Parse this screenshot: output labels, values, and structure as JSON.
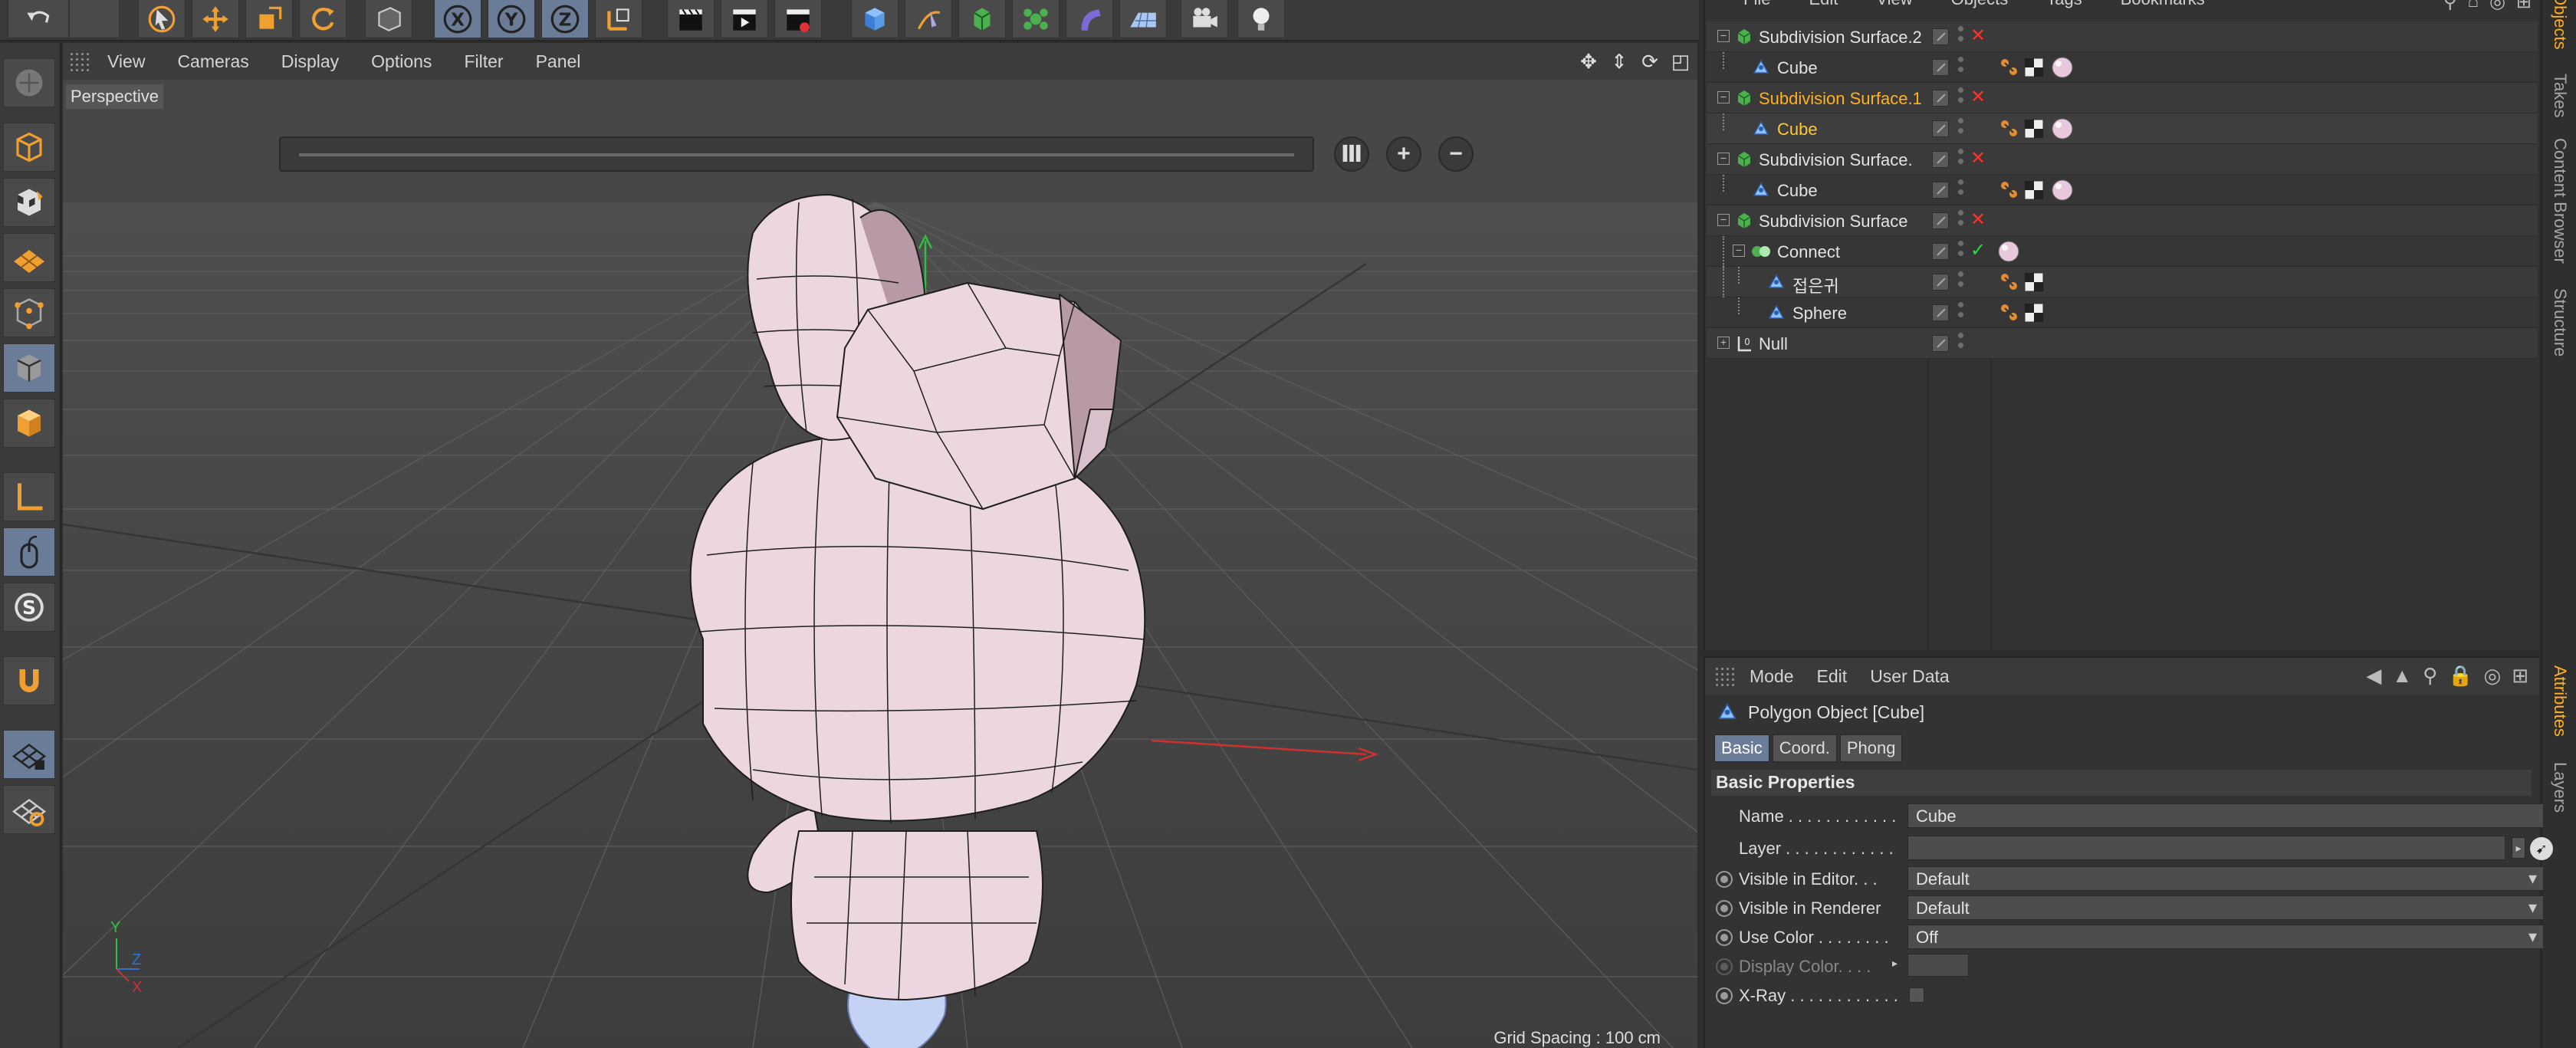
{
  "viewport": {
    "menu": [
      "View",
      "Cameras",
      "Display",
      "Options",
      "Filter",
      "Panel"
    ],
    "camera": "Perspective",
    "grid_spacing": "Grid Spacing : 100 cm",
    "axis_labels": {
      "y": "Y",
      "z": "Z",
      "x": "X"
    }
  },
  "object_manager": {
    "menu": [
      "File",
      "Edit",
      "View",
      "Objects",
      "Tags",
      "Bookmarks"
    ],
    "objects": [
      {
        "name": "Subdivision Surface.2",
        "type": "subdivision",
        "level": 0,
        "state": "normal"
      },
      {
        "name": "Cube",
        "type": "polygon",
        "level": 1,
        "state": "normal"
      },
      {
        "name": "Subdivision Surface.1",
        "type": "subdivision",
        "level": 0,
        "state": "selected-parent"
      },
      {
        "name": "Cube",
        "type": "polygon",
        "level": 1,
        "state": "selected"
      },
      {
        "name": "Subdivision Surface.",
        "type": "subdivision",
        "level": 0,
        "state": "normal"
      },
      {
        "name": "Cube",
        "type": "polygon",
        "level": 1,
        "state": "normal"
      },
      {
        "name": "Subdivision Surface",
        "type": "subdivision",
        "level": 0,
        "state": "normal"
      },
      {
        "name": "Connect",
        "type": "connect",
        "level": 1,
        "state": "normal"
      },
      {
        "name": "접은귀",
        "type": "polygon",
        "level": 2,
        "state": "normal"
      },
      {
        "name": "Sphere",
        "type": "polygon",
        "level": 2,
        "state": "normal"
      },
      {
        "name": "Null",
        "type": "null",
        "level": 0,
        "state": "normal"
      }
    ]
  },
  "side_tabs_top": [
    "Objects",
    "Takes",
    "Content Browser",
    "Structure"
  ],
  "side_tabs_bottom": [
    "Attributes",
    "Layers"
  ],
  "attributes": {
    "menu": [
      "Mode",
      "Edit",
      "User Data"
    ],
    "title": "Polygon Object [Cube]",
    "tabs": [
      "Basic",
      "Coord.",
      "Phong"
    ],
    "section": "Basic Properties",
    "properties": [
      {
        "label": "Name . . . . . . . . . . . .",
        "value": "Cube",
        "kind": "text"
      },
      {
        "label": "Layer . . . . . . . . . . . .",
        "value": "",
        "kind": "layer"
      },
      {
        "label": "Visible in Editor. . .",
        "value": "Default",
        "kind": "dropdown"
      },
      {
        "label": "Visible in Renderer",
        "value": "Default",
        "kind": "dropdown"
      },
      {
        "label": "Use Color . . . . . . . .",
        "value": "Off",
        "kind": "dropdown"
      },
      {
        "label": "Display Color. . . .",
        "value": "",
        "kind": "color"
      },
      {
        "label": "X-Ray . . . . . . . . . . . .",
        "value": "",
        "kind": "checkbox"
      }
    ]
  },
  "colors": {
    "accent": "#ffb020",
    "selection": "#6b7c99",
    "mesh": "#ecd6e0",
    "x_axis": "#d03030",
    "y_axis": "#30c040"
  }
}
